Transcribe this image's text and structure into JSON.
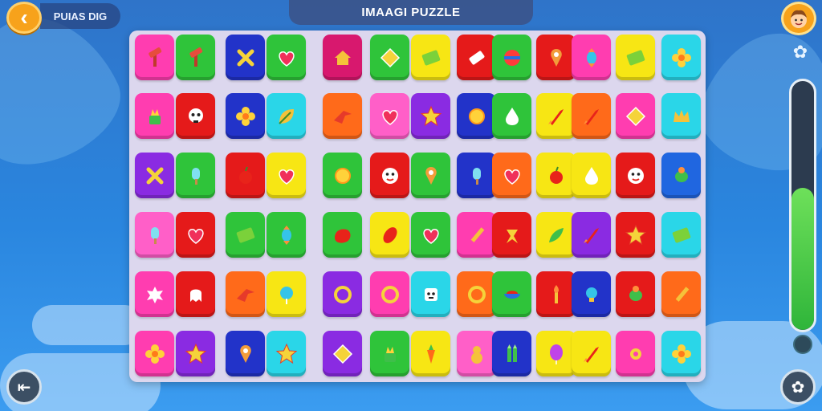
{
  "header": {
    "back_icon": "chevron-left-icon",
    "level_text": "PUIAS DIG",
    "title": "IMAAGI PUZZLE",
    "avatar_icon": "boy-face-icon",
    "side_icon": "puzzle-piece-icon"
  },
  "progress": {
    "level": 0.57,
    "color": "#3fc34a"
  },
  "bottom": {
    "left_button_icon": "exit-arrow-icon",
    "right_button_icon": "flower-settings-icon"
  },
  "board": {
    "tiles": [
      {
        "color": "#ff3db0",
        "icon": "hammer-icon"
      },
      {
        "color": "#2fc43a",
        "icon": "hammer-icon"
      },
      {
        "color": "#2233c9",
        "icon": "cross-icon"
      },
      {
        "color": "#2fc43a",
        "icon": "heart-icon"
      },
      {
        "color": "#d8186e",
        "icon": "house-icon"
      },
      {
        "color": "#2fc43a",
        "icon": "diamond-icon"
      },
      {
        "color": "#f7e614",
        "icon": "stripes-icon"
      },
      {
        "color": "#e51a1a",
        "icon": "eraser-icon"
      },
      {
        "color": "#2fc43a",
        "icon": "ball-icon"
      },
      {
        "color": "#e51a1a",
        "icon": "pin-icon"
      },
      {
        "color": "#ff3db0",
        "icon": "candy-icon"
      },
      {
        "color": "#f7e614",
        "icon": "stripes-icon"
      },
      {
        "color": "#2ad6e8",
        "icon": "flower-icon"
      },
      {
        "color": "#ff3db0",
        "icon": "plant-icon"
      },
      {
        "color": "#e51a1a",
        "icon": "skull-icon"
      },
      {
        "color": "#2233c9",
        "icon": "flower-icon"
      },
      {
        "color": "#2ad6e8",
        "icon": "leaf-icon"
      },
      {
        "color": "#ff6a1a",
        "icon": "bird-icon"
      },
      {
        "color": "#ff5fc8",
        "icon": "heart-icon"
      },
      {
        "color": "#8a2be2",
        "icon": "star-icon"
      },
      {
        "color": "#2233c9",
        "icon": "sun-icon"
      },
      {
        "color": "#2fc43a",
        "icon": "drop-icon"
      },
      {
        "color": "#f7e614",
        "icon": "rocket-icon"
      },
      {
        "color": "#ff6a1a",
        "icon": "rocket-icon"
      },
      {
        "color": "#ff3db0",
        "icon": "diamond-icon"
      },
      {
        "color": "#2ad6e8",
        "icon": "crown-icon"
      },
      {
        "color": "#8a2be2",
        "icon": "cross-icon"
      },
      {
        "color": "#2fc43a",
        "icon": "popsicle-icon"
      },
      {
        "color": "#e51a1a",
        "icon": "apple-icon"
      },
      {
        "color": "#f7e614",
        "icon": "heart-icon"
      },
      {
        "color": "#2fc43a",
        "icon": "sun-icon"
      },
      {
        "color": "#e51a1a",
        "icon": "face-icon"
      },
      {
        "color": "#2fc43a",
        "icon": "pin-icon"
      },
      {
        "color": "#2233c9",
        "icon": "popsicle-icon"
      },
      {
        "color": "#ff6a1a",
        "icon": "heart-icon"
      },
      {
        "color": "#f7e614",
        "icon": "apple-icon"
      },
      {
        "color": "#f7e614",
        "icon": "drop-icon"
      },
      {
        "color": "#e51a1a",
        "icon": "face-icon"
      },
      {
        "color": "#2066e0",
        "icon": "bug-icon"
      },
      {
        "color": "#ff5fc8",
        "icon": "popsicle-icon"
      },
      {
        "color": "#e51a1a",
        "icon": "heart-icon"
      },
      {
        "color": "#2fc43a",
        "icon": "stripes-icon"
      },
      {
        "color": "#2fc43a",
        "icon": "candy-icon"
      },
      {
        "color": "#2fc43a",
        "icon": "blob-icon"
      },
      {
        "color": "#f7e614",
        "icon": "bread-icon"
      },
      {
        "color": "#2fc43a",
        "icon": "heart-icon"
      },
      {
        "color": "#ff3db0",
        "icon": "pencil-icon"
      },
      {
        "color": "#e51a1a",
        "icon": "ribbon-icon"
      },
      {
        "color": "#f7e614",
        "icon": "feather-icon"
      },
      {
        "color": "#8a2be2",
        "icon": "rocket-icon"
      },
      {
        "color": "#e51a1a",
        "icon": "star-icon"
      },
      {
        "color": "#2ad6e8",
        "icon": "stripes-icon"
      },
      {
        "color": "#ff3db0",
        "icon": "splash-icon"
      },
      {
        "color": "#e51a1a",
        "icon": "ghost-icon"
      },
      {
        "color": "#ff6a1a",
        "icon": "bird-icon"
      },
      {
        "color": "#f7e614",
        "icon": "lollipop-icon"
      },
      {
        "color": "#8a2be2",
        "icon": "ring-icon"
      },
      {
        "color": "#ff3db0",
        "icon": "ring-icon"
      },
      {
        "color": "#2ad6e8",
        "icon": "robot-icon"
      },
      {
        "color": "#ff6a1a",
        "icon": "ring-icon"
      },
      {
        "color": "#2fc43a",
        "icon": "bowl-icon"
      },
      {
        "color": "#e51a1a",
        "icon": "torch-icon"
      },
      {
        "color": "#2233c9",
        "icon": "bulb-icon"
      },
      {
        "color": "#e51a1a",
        "icon": "bug-icon"
      },
      {
        "color": "#ff6a1a",
        "icon": "pencil-icon"
      },
      {
        "color": "#ff3db0",
        "icon": "flower-icon"
      },
      {
        "color": "#8a2be2",
        "icon": "star-icon"
      },
      {
        "color": "#2233c9",
        "icon": "pin-icon"
      },
      {
        "color": "#2ad6e8",
        "icon": "star-icon"
      },
      {
        "color": "#8a2be2",
        "icon": "diamond-icon"
      },
      {
        "color": "#2fc43a",
        "icon": "plant-icon"
      },
      {
        "color": "#f7e614",
        "icon": "carrot-icon"
      },
      {
        "color": "#ff5fc8",
        "icon": "gourd-icon"
      },
      {
        "color": "#2233c9",
        "icon": "crayon-icon"
      },
      {
        "color": "#f7e614",
        "icon": "balloon-icon"
      },
      {
        "color": "#f7e614",
        "icon": "rocket-icon"
      },
      {
        "color": "#ff3db0",
        "icon": "pacifier-icon"
      },
      {
        "color": "#2ad6e8",
        "icon": "flower-icon"
      }
    ]
  }
}
